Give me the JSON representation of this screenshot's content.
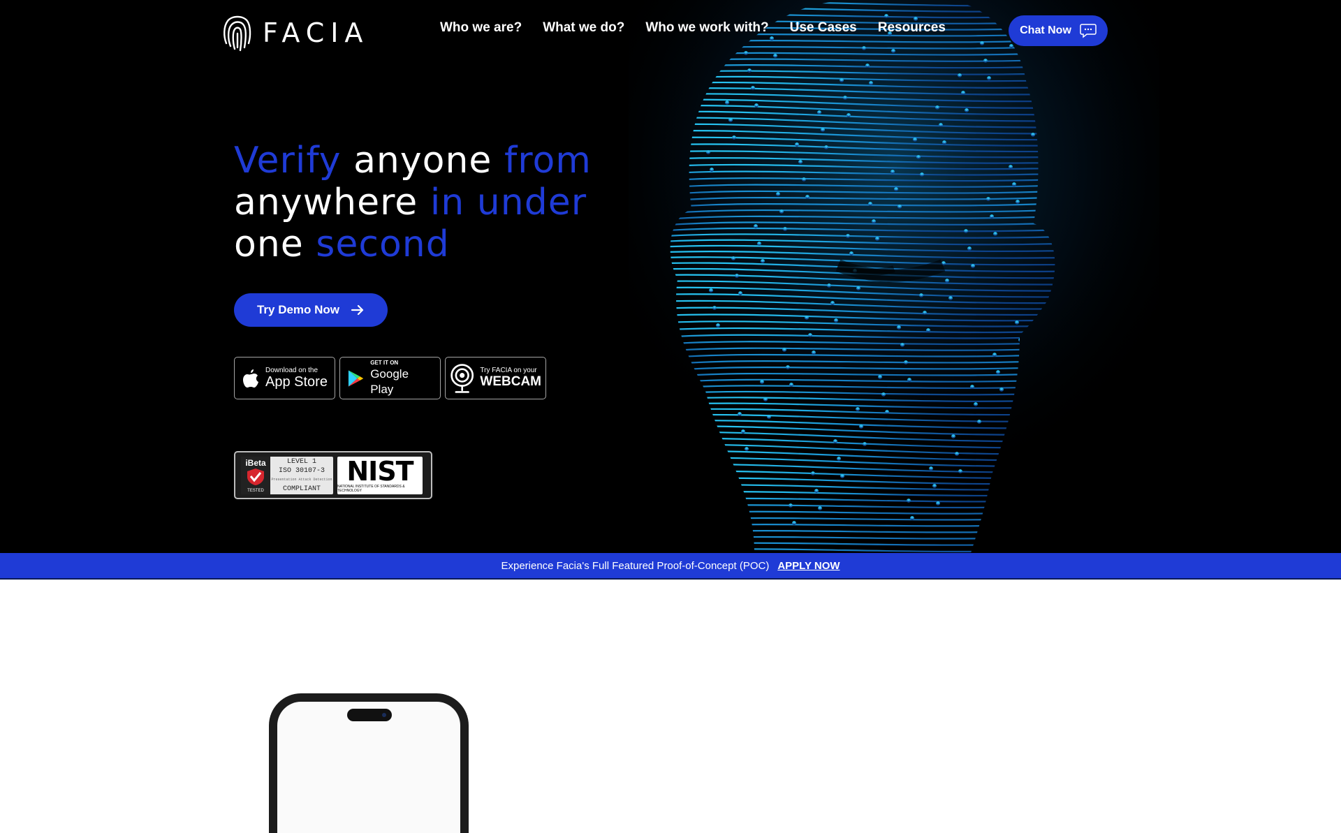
{
  "brand": {
    "name": "FACIA",
    "logo_icon": "fingerprint-icon"
  },
  "colors": {
    "accent": "#1f3bd6",
    "background": "#000000",
    "text": "#ffffff",
    "head_glow": "#19c8f0"
  },
  "nav": {
    "items": [
      "Who we are?",
      "What we do?",
      "Who we work with?",
      "Use Cases",
      "Resources"
    ],
    "chat_label": "Chat Now",
    "chat_icon": "chat-bubble-icon"
  },
  "hero": {
    "headline": [
      [
        {
          "t": "Verify ",
          "accent": true
        },
        {
          "t": "anyone ",
          "accent": false
        },
        {
          "t": "from",
          "accent": true
        }
      ],
      [
        {
          "t": "anywhere ",
          "accent": false
        },
        {
          "t": "in under",
          "accent": true
        }
      ],
      [
        {
          "t": "one ",
          "accent": false
        },
        {
          "t": "second",
          "accent": true
        }
      ]
    ],
    "demo_label": "Try Demo Now",
    "demo_icon": "arrow-right-icon"
  },
  "badges": {
    "appstore": {
      "small": "Download on the",
      "big": "App Store",
      "icon": "apple-icon"
    },
    "googleplay": {
      "small": "GET IT ON",
      "big": "Google Play",
      "icon": "play-triangle-icon"
    },
    "webcam": {
      "small": "Try FACIA on your",
      "big": "WEBCAM",
      "icon": "webcam-icon"
    }
  },
  "certs": {
    "ibeta": {
      "brand": "iBeta",
      "tested": "TESTED",
      "level": "LEVEL 1",
      "iso": "ISO 30107-3",
      "pad": "Presentation Attack Detection",
      "status": "COMPLIANT"
    },
    "nist": {
      "logo": "NIST",
      "full": "NATIONAL INSTITUTE OF STANDARDS & TECHNOLOGY"
    }
  },
  "banner": {
    "text": "Experience Facia's Full Featured Proof-of-Concept (POC)",
    "link": "APPLY NOW"
  }
}
